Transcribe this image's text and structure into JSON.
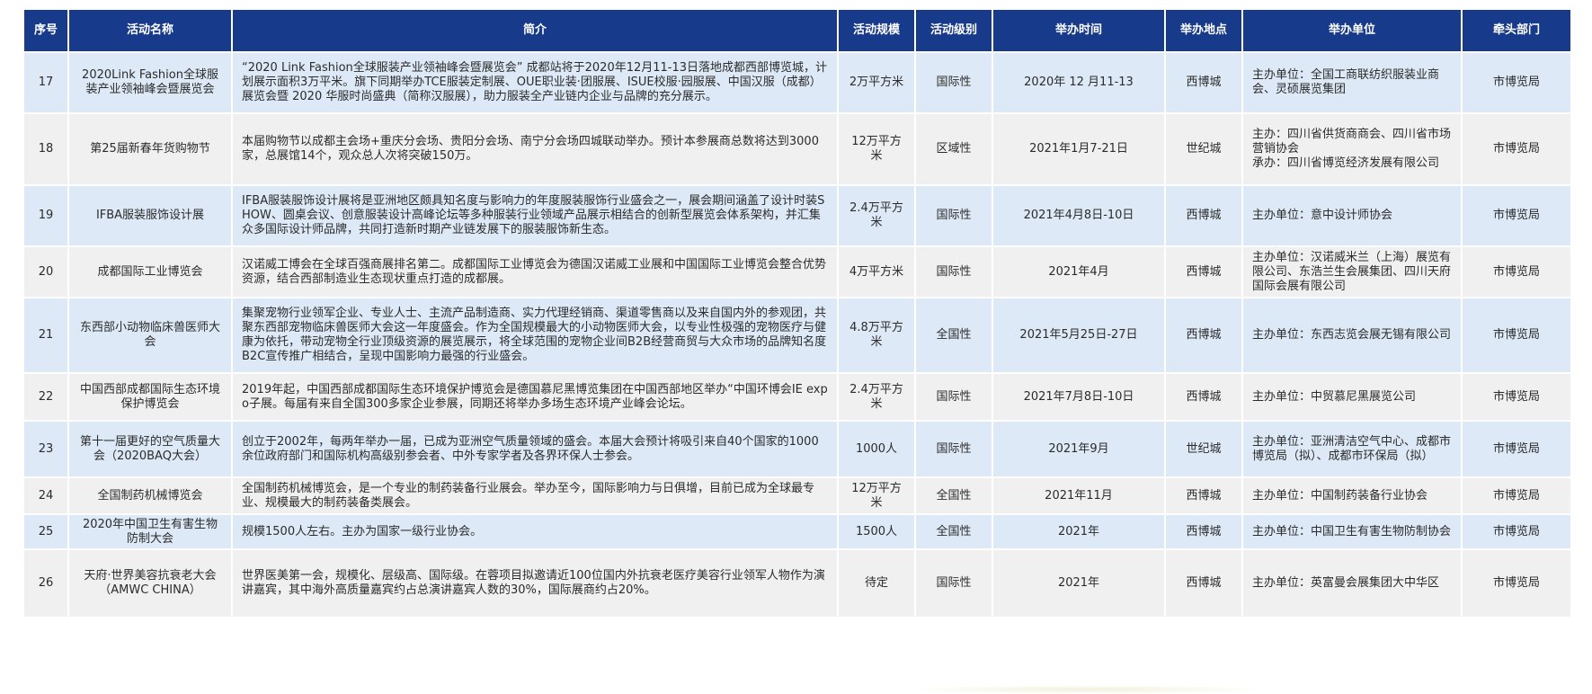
{
  "headers": [
    "序号",
    "活动名称",
    "简介",
    "活动规模",
    "活动级别",
    "举办时间",
    "举办地点",
    "举办单位",
    "牵头部门"
  ],
  "rows": [
    {
      "no": "17",
      "name": "2020Link Fashion全球服装产业领袖峰会暨展览会",
      "intro": "“2020 Link Fashion全球服装产业领袖峰会暨展览会” 成都站将于2020年12月11-13日落地成都西部博览城，计划展示面积3万平米。旗下同期举办TCE服装定制展、OUE职业装·团服展、ISUE校服·园服展、中国汉服（成都）展览会暨 2020 华服时尚盛典（简称汉服展），助力服装全产业链内企业与品牌的充分展示。",
      "scale": "2万平方米",
      "level": "国际性",
      "time": "2020年 12 月11-13",
      "venue": "西博城",
      "organizer": "主办单位：全国工商联纺织服装业商会、灵硕展览集团",
      "dept": "市博览局"
    },
    {
      "no": "18",
      "name": "第25届新春年货购物节",
      "intro": "本届购物节以成都主会场+重庆分会场、贵阳分会场、南宁分会场四城联动举办。预计本参展商总数将达到3000家，总展馆14个，观众总人次将突破150万。",
      "scale": "12万平方米",
      "level": "区域性",
      "time": "2021年1月7-21日",
      "venue": "世纪城",
      "organizer": "主办：四川省供货商商会、四川省市场营销协会\n 承办：四川省博览经济发展有限公司",
      "dept": "市博览局"
    },
    {
      "no": "19",
      "name": "IFBA服装服饰设计展",
      "intro": "IFBA服装服饰设计展将是亚洲地区颇具知名度与影响力的年度服装服饰行业盛会之一，展会期间涵盖了设计时装SHOW、圆桌会议、创意服装设计高峰论坛等多种服装行业领域产品展示相结合的创新型展览会体系架构，并汇集众多国际设计师品牌，共同打造新时期产业链发展下的服装服饰新生态。",
      "scale": "2.4万平方米",
      "level": "国际性",
      "time": "2021年4月8日-10日",
      "venue": "西博城",
      "organizer": "主办单位：意中设计师协会",
      "dept": "市博览局"
    },
    {
      "no": "20",
      "name": "成都国际工业博览会",
      "intro": "汉诺威工博会在全球百强商展排名第二。成都国际工业博览会为德国汉诺威工业展和中国国际工业博览会整合优势资源，结合西部制造业生态现状重点打造的成都展。",
      "scale": "4万平方米",
      "level": "国际性",
      "time": "2021年4月",
      "venue": "西博城",
      "organizer": "主办单位：汉诺威米兰（上海）展览有限公司、东浩兰生会展集团、四川天府国际会展有限公司",
      "dept": "市博览局"
    },
    {
      "no": "21",
      "name": "东西部小动物临床兽医师大会",
      "intro": "集聚宠物行业领军企业、专业人士、主流产品制造商、实力代理经销商、渠道零售商以及来自国内外的参观团，共聚东西部宠物临床兽医师大会这一年度盛会。作为全国规模最大的小动物医师大会，以专业性极强的宠物医疗与健康为依托，带动宠物全行业顶级资源的展览展示，将全球范围的宠物企业间B2B经营商贸与大众市场的品牌知名度B2C宣传推广相结合，呈现中国影响力最强的行业盛会。",
      "scale": "4.8万平方米",
      "level": "全国性",
      "time": "2021年5月25日-27日",
      "venue": "西博城",
      "organizer": "主办单位：东西志览会展无锡有限公司",
      "dept": "市博览局"
    },
    {
      "no": "22",
      "name": "中国西部成都国际生态环境保护博览会",
      "intro": "2019年起，中国西部成都国际生态环境保护博览会是德国慕尼黑博览集团在中国西部地区举办“中国环博会IE expo子展。每届有来自全国300多家企业参展，同期还将举办多场生态环境产业峰会论坛。",
      "scale": "2.4万平方米",
      "level": "国际性",
      "time": "2021年7月8日-10日",
      "venue": "西博城",
      "organizer": "主办单位：中贸慕尼黑展览公司",
      "dept": "市博览局"
    },
    {
      "no": "23",
      "name": "第十一届更好的空气质量大会（2020BAQ大会）",
      "intro": " 创立于2002年，每两年举办一届，已成为亚洲空气质量领域的盛会。本届大会预计将吸引来自40个国家的1000余位政府部门和国际机构高级别参会者、中外专家学者及各界环保人士参会。",
      "scale": "1000人",
      "level": "国际性",
      "time": "2021年9月",
      "venue": "世纪城",
      "organizer": "主办单位：亚洲清洁空气中心、成都市博览局（拟）、成都市环保局（拟）",
      "dept": "市博览局"
    },
    {
      "no": "24",
      "name": "全国制药机械博览会",
      "intro": "全国制药机械博览会，是一个专业的制药装备行业展会。举办至今，国际影响力与日俱增，目前已成为全球最专业、规模最大的制药装备类展会。",
      "scale": "12万平方米",
      "level": "全国性",
      "time": "2021年11月",
      "venue": "西博城",
      "organizer": "主办单位：中国制药装备行业协会",
      "dept": "市博览局"
    },
    {
      "no": "25",
      "name": "2020年中国卫生有害生物防制大会",
      "intro": " 规模1500人左右。主办为国家一级行业协会。",
      "scale": "1500人",
      "level": "全国性",
      "time": "2021年",
      "venue": "西博城",
      "organizer": "主办单位：中国卫生有害生物防制协会",
      "dept": "市博览局"
    },
    {
      "no": "26",
      "name": "天府·世界美容抗衰老大会（AMWC CHINA）",
      "intro": "世界医美第一会，规模化、层级高、国际级。在蓉项目拟邀请近100位国内外抗衰老医疗美容行业领军人物作为演讲嘉宾，其中海外高质量嘉宾约占总演讲嘉宾人数的30%，国际展商约占20%。",
      "scale": "待定",
      "level": "国际性",
      "time": "2021年",
      "venue": "西博城",
      "organizer": "主办单位：英富曼会展集团大中华区",
      "dept": "市博览局"
    }
  ]
}
